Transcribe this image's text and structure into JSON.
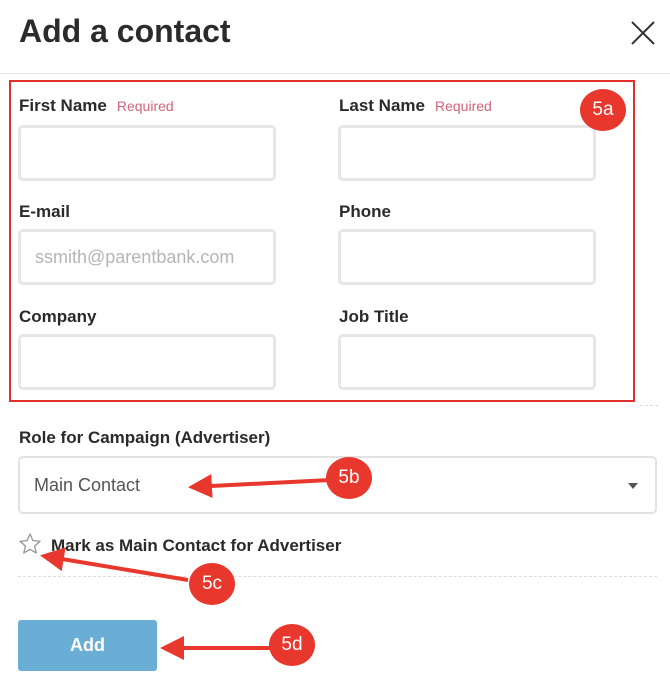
{
  "dialog": {
    "title": "Add a contact"
  },
  "form": {
    "first_name": {
      "label": "First Name",
      "required": "Required",
      "value": "",
      "placeholder": ""
    },
    "last_name": {
      "label": "Last Name",
      "required": "Required",
      "value": "",
      "placeholder": ""
    },
    "email": {
      "label": "E-mail",
      "value": "",
      "placeholder": "ssmith@parentbank.com"
    },
    "phone": {
      "label": "Phone",
      "value": "",
      "placeholder": ""
    },
    "company": {
      "label": "Company",
      "value": "",
      "placeholder": ""
    },
    "job_title": {
      "label": "Job Title",
      "value": "",
      "placeholder": ""
    }
  },
  "role": {
    "label": "Role for Campaign (Advertiser)",
    "selected": "Main Contact"
  },
  "main_contact": {
    "label": "Mark as Main Contact for Advertiser",
    "checked": false
  },
  "actions": {
    "add_label": "Add"
  },
  "annotations": {
    "badge_5a": "5a",
    "badge_5b": "5b",
    "badge_5c": "5c",
    "badge_5d": "5d",
    "color": "#e8372c"
  },
  "colors": {
    "primary_button": "#6aaed6",
    "required_text": "#d2637a"
  }
}
